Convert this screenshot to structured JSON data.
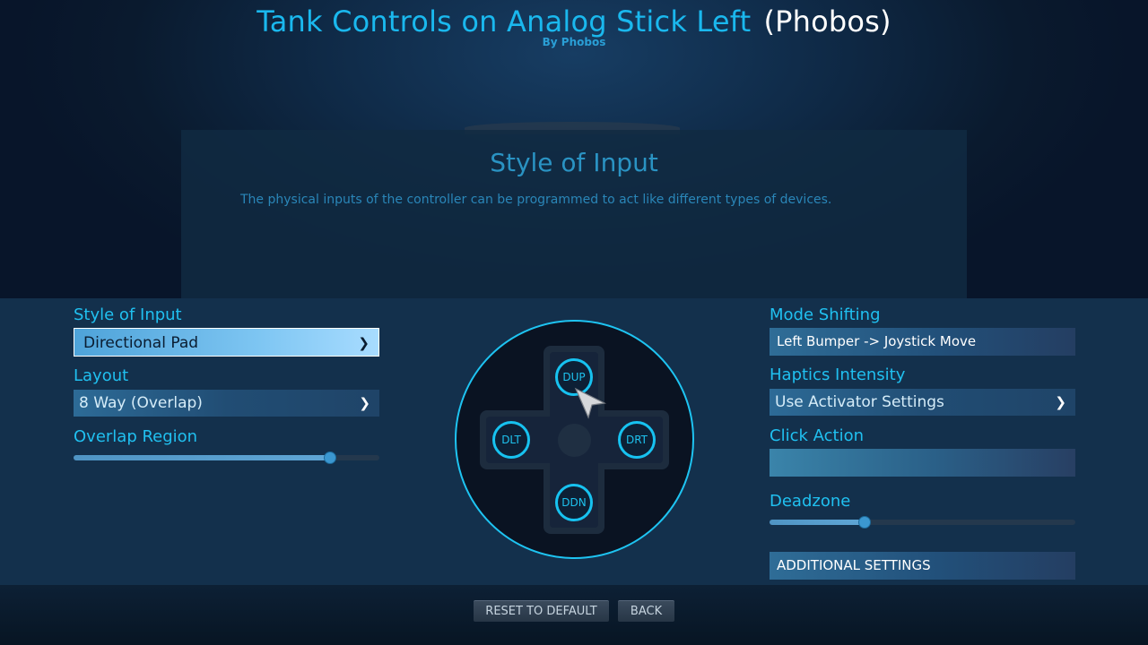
{
  "header": {
    "title": "Tank Controls on Analog Stick Left",
    "title_suffix": "(Phobos)",
    "byline": "By Phobos"
  },
  "info_panel": {
    "title": "Style of Input",
    "description": "The physical inputs of the controller can be programmed to act like different types of devices."
  },
  "left_column": {
    "style_of_input": {
      "label": "Style of Input",
      "value": "Directional Pad"
    },
    "layout": {
      "label": "Layout",
      "value": "8 Way (Overlap)"
    },
    "overlap_region": {
      "label": "Overlap Region",
      "value": 0.84
    }
  },
  "dpad": {
    "up": "DUP",
    "left": "DLT",
    "right": "DRT",
    "down": "DDN"
  },
  "right_column": {
    "mode_shifting": {
      "label": "Mode Shifting",
      "value": "Left Bumper -> Joystick Move"
    },
    "haptics_intensity": {
      "label": "Haptics Intensity",
      "value": "Use Activator Settings"
    },
    "click_action": {
      "label": "Click Action",
      "value": ""
    },
    "deadzone": {
      "label": "Deadzone",
      "value": 0.31
    },
    "additional_settings": "ADDITIONAL SETTINGS"
  },
  "footer": {
    "reset_label": "RESET TO DEFAULT",
    "back_label": "BACK"
  },
  "icons": {
    "dropdown": "chevron-down-icon",
    "cursor": "cursor-arrow-icon"
  },
  "colors": {
    "accent": "#1ab8ee",
    "panel_bg": "#13304c"
  }
}
